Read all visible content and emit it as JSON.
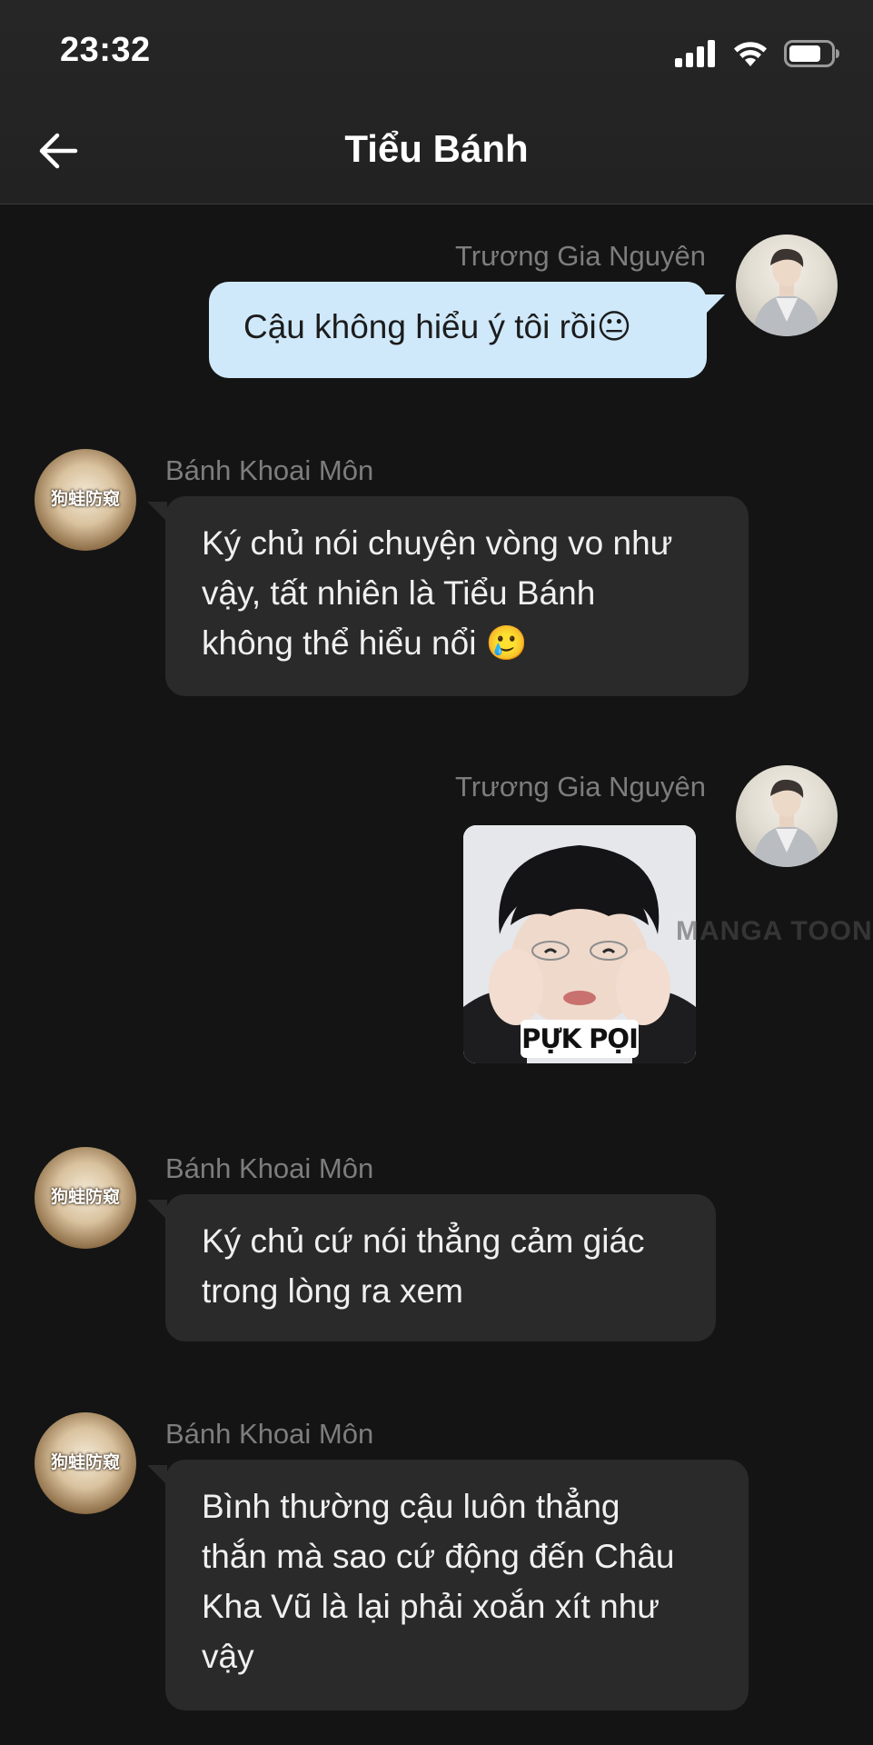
{
  "status_bar": {
    "time": "23:32",
    "icons": [
      "cellular-signal-icon",
      "wifi-icon",
      "battery-icon"
    ]
  },
  "nav": {
    "back_icon": "back-arrow-icon",
    "title": "Tiểu Bánh"
  },
  "messages": [
    {
      "direction": "outgoing",
      "sender": "Trương Gia Nguyên",
      "text": "Cậu không hiểu ý tôi rồi😐"
    },
    {
      "direction": "incoming",
      "sender": "Bánh Khoai Môn",
      "avatar_text": "狗蛙防窥",
      "lines": [
        "Ký chủ nói chuyện vòng vo như",
        "vậy, tất nhiên là Tiểu Bánh",
        "không thể hiểu nổi 🥲"
      ]
    },
    {
      "direction": "outgoing",
      "sender": "Trương Gia Nguyên",
      "sticker_caption": "PỰK PỌI"
    },
    {
      "direction": "incoming",
      "sender": "Bánh Khoai Môn",
      "avatar_text": "狗蛙防窥",
      "lines": [
        "Ký chủ cứ nói thẳng cảm giác",
        "trong lòng ra xem"
      ]
    },
    {
      "direction": "incoming",
      "sender": "Bánh Khoai Môn",
      "avatar_text": "狗蛙防窥",
      "lines": [
        "Bình thường cậu luôn thẳng",
        "thắn mà sao cứ động đến Châu",
        "Kha Vũ là lại phải xoắn xít như",
        "vậy"
      ]
    }
  ],
  "watermark": "MANGA TOON",
  "colors": {
    "background": "#141414",
    "incoming_bubble": "#2a2a2a",
    "outgoing_bubble": "#cfe9fb",
    "sender_name": "#7d7d7d"
  }
}
